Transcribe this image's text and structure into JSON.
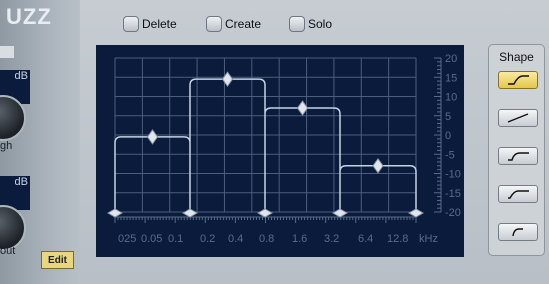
{
  "left_panel": {
    "title": "UZZ",
    "high_display": "dB",
    "high_label": "gh",
    "out_display": "dB",
    "out_label": "out",
    "edit_label": "Edit"
  },
  "toolbar": {
    "delete_label": "Delete",
    "create_label": "Create",
    "solo_label": "Solo"
  },
  "graph": {
    "db_labels": [
      "20",
      "15",
      "10",
      "5",
      "0",
      "-5",
      "-10",
      "-15",
      "-20"
    ],
    "freq_labels": [
      "025",
      "0.05",
      "0.1",
      "0.2",
      "0.4",
      "0.8",
      "1.6",
      "3.2",
      "6.4",
      "12.8",
      "kHz"
    ],
    "bands": [
      {
        "level_db": -0.5
      },
      {
        "level_db": 14.5
      },
      {
        "level_db": 7
      },
      {
        "level_db": -8
      }
    ],
    "colors": {
      "background": "#0b1b3c",
      "grid": "#4b5e7d",
      "curve": "#c6d3e6",
      "handle": "#e2e6ea",
      "labels": "#5a6b86"
    }
  },
  "shape_panel": {
    "title": "Shape",
    "buttons": [
      {
        "icon": "shape-steep-curve-icon",
        "active": true
      },
      {
        "icon": "shape-gentle-slope-icon",
        "active": false
      },
      {
        "icon": "shape-soft-curve-icon",
        "active": false
      },
      {
        "icon": "shape-medium-curve-icon",
        "active": false
      },
      {
        "icon": "shape-vertical-curve-icon",
        "active": false
      }
    ]
  }
}
